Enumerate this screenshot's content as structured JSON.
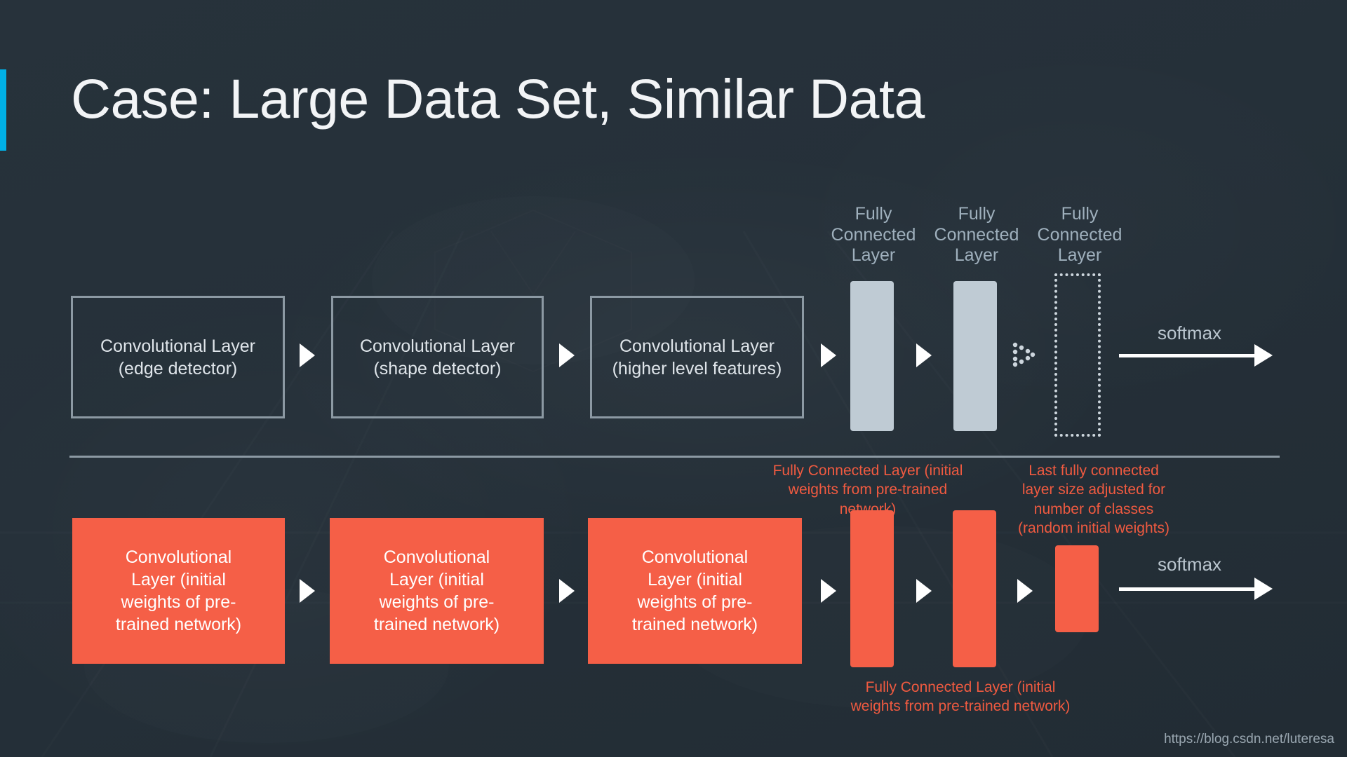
{
  "slide": {
    "title": "Case: Large Data Set, Similar Data",
    "accent_color": "#00b0e6",
    "background_color": "#253039",
    "highlight_color": "#f55f47",
    "neutral_box_color": "#bfcbd4",
    "watermark": "https://blog.csdn.net/luteresa"
  },
  "top_row": {
    "conv_boxes": [
      {
        "label": "Convolutional Layer (edge detector)"
      },
      {
        "label": "Convolutional Layer (shape detector)"
      },
      {
        "label": "Convolutional Layer (higher level features)"
      }
    ],
    "fc_labels": [
      "Fully Connected Layer",
      "Fully Connected Layer",
      "Fully Connected Layer"
    ],
    "softmax_label": "softmax"
  },
  "bottom_row": {
    "conv_boxes": [
      {
        "label": "Convolutional Layer (initial weights of pre-trained network)"
      },
      {
        "label": "Convolutional Layer (initial weights of pre-trained network)"
      },
      {
        "label": "Convolutional Layer (initial weights of pre-trained network)"
      }
    ],
    "softmax_label": "softmax"
  },
  "annotations": {
    "top_left": "Fully Connected Layer (initial weights from pre-trained network)",
    "top_right": "Last fully connected layer size adjusted for number of classes (random initial weights)",
    "bottom": "Fully Connected Layer (initial weights from pre-trained network)"
  }
}
